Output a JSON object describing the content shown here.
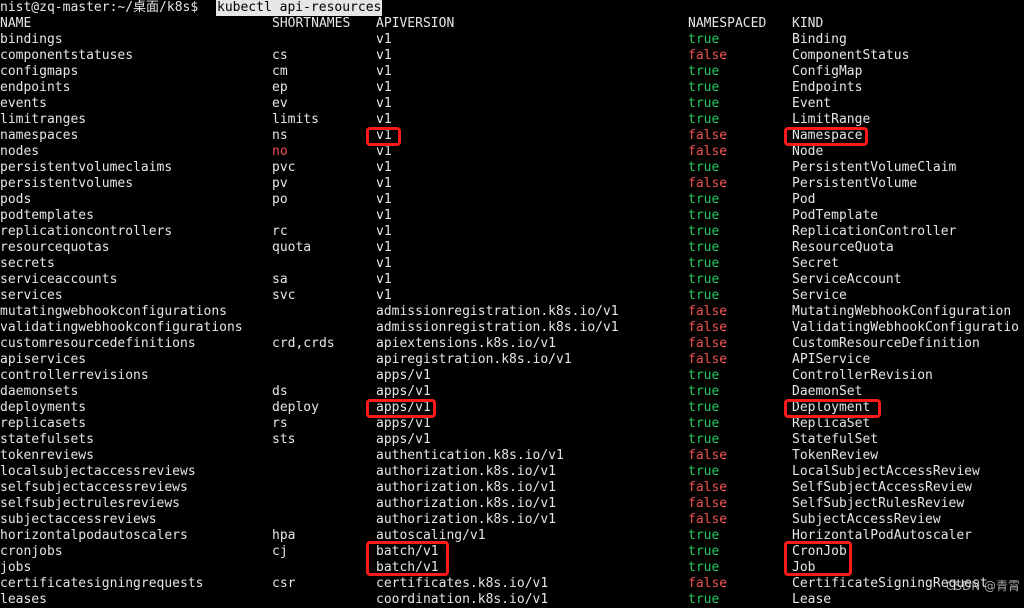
{
  "terminal": {
    "prompt": "nist@zq-master:~/桌面/k8s$ ",
    "command": "kubectl api-resources",
    "headers": {
      "name": "NAME",
      "shortnames": "SHORTNAMES",
      "apiversion": "APIVERSION",
      "namespaced": "NAMESPACED",
      "kind": "KIND"
    },
    "rows": [
      {
        "name": "bindings",
        "short": "",
        "api": "v1",
        "ns": "true",
        "kind": "Binding"
      },
      {
        "name": "componentstatuses",
        "short": "cs",
        "api": "v1",
        "ns": "false",
        "kind": "ComponentStatus"
      },
      {
        "name": "configmaps",
        "short": "cm",
        "api": "v1",
        "ns": "true",
        "kind": "ConfigMap"
      },
      {
        "name": "endpoints",
        "short": "ep",
        "api": "v1",
        "ns": "true",
        "kind": "Endpoints"
      },
      {
        "name": "events",
        "short": "ev",
        "api": "v1",
        "ns": "true",
        "kind": "Event"
      },
      {
        "name": "limitranges",
        "short": "limits",
        "api": "v1",
        "ns": "true",
        "kind": "LimitRange"
      },
      {
        "name": "namespaces",
        "short": "ns",
        "api": "v1",
        "ns": "false",
        "kind": "Namespace"
      },
      {
        "name": "nodes",
        "short": "no",
        "api": "v1",
        "ns": "false",
        "kind": "Node"
      },
      {
        "name": "persistentvolumeclaims",
        "short": "pvc",
        "api": "v1",
        "ns": "true",
        "kind": "PersistentVolumeClaim"
      },
      {
        "name": "persistentvolumes",
        "short": "pv",
        "api": "v1",
        "ns": "false",
        "kind": "PersistentVolume"
      },
      {
        "name": "pods",
        "short": "po",
        "api": "v1",
        "ns": "true",
        "kind": "Pod"
      },
      {
        "name": "podtemplates",
        "short": "",
        "api": "v1",
        "ns": "true",
        "kind": "PodTemplate"
      },
      {
        "name": "replicationcontrollers",
        "short": "rc",
        "api": "v1",
        "ns": "true",
        "kind": "ReplicationController"
      },
      {
        "name": "resourcequotas",
        "short": "quota",
        "api": "v1",
        "ns": "true",
        "kind": "ResourceQuota"
      },
      {
        "name": "secrets",
        "short": "",
        "api": "v1",
        "ns": "true",
        "kind": "Secret"
      },
      {
        "name": "serviceaccounts",
        "short": "sa",
        "api": "v1",
        "ns": "true",
        "kind": "ServiceAccount"
      },
      {
        "name": "services",
        "short": "svc",
        "api": "v1",
        "ns": "true",
        "kind": "Service"
      },
      {
        "name": "mutatingwebhookconfigurations",
        "short": "",
        "api": "admissionregistration.k8s.io/v1",
        "ns": "false",
        "kind": "MutatingWebhookConfiguration"
      },
      {
        "name": "validatingwebhookconfigurations",
        "short": "",
        "api": "admissionregistration.k8s.io/v1",
        "ns": "false",
        "kind": "ValidatingWebhookConfiguratio"
      },
      {
        "name": "customresourcedefinitions",
        "short": "crd,crds",
        "api": "apiextensions.k8s.io/v1",
        "ns": "false",
        "kind": "CustomResourceDefinition"
      },
      {
        "name": "apiservices",
        "short": "",
        "api": "apiregistration.k8s.io/v1",
        "ns": "false",
        "kind": "APIService"
      },
      {
        "name": "controllerrevisions",
        "short": "",
        "api": "apps/v1",
        "ns": "true",
        "kind": "ControllerRevision"
      },
      {
        "name": "daemonsets",
        "short": "ds",
        "api": "apps/v1",
        "ns": "true",
        "kind": "DaemonSet"
      },
      {
        "name": "deployments",
        "short": "deploy",
        "api": "apps/v1",
        "ns": "true",
        "kind": "Deployment"
      },
      {
        "name": "replicasets",
        "short": "rs",
        "api": "apps/v1",
        "ns": "true",
        "kind": "ReplicaSet"
      },
      {
        "name": "statefulsets",
        "short": "sts",
        "api": "apps/v1",
        "ns": "true",
        "kind": "StatefulSet"
      },
      {
        "name": "tokenreviews",
        "short": "",
        "api": "authentication.k8s.io/v1",
        "ns": "false",
        "kind": "TokenReview"
      },
      {
        "name": "localsubjectaccessreviews",
        "short": "",
        "api": "authorization.k8s.io/v1",
        "ns": "true",
        "kind": "LocalSubjectAccessReview"
      },
      {
        "name": "selfsubjectaccessreviews",
        "short": "",
        "api": "authorization.k8s.io/v1",
        "ns": "false",
        "kind": "SelfSubjectAccessReview"
      },
      {
        "name": "selfsubjectrulesreviews",
        "short": "",
        "api": "authorization.k8s.io/v1",
        "ns": "false",
        "kind": "SelfSubjectRulesReview"
      },
      {
        "name": "subjectaccessreviews",
        "short": "",
        "api": "authorization.k8s.io/v1",
        "ns": "false",
        "kind": "SubjectAccessReview"
      },
      {
        "name": "horizontalpodautoscalers",
        "short": "hpa",
        "api": "autoscaling/v1",
        "ns": "true",
        "kind": "HorizontalPodAutoscaler"
      },
      {
        "name": "cronjobs",
        "short": "cj",
        "api": "batch/v1",
        "ns": "true",
        "kind": "CronJob"
      },
      {
        "name": "jobs",
        "short": "",
        "api": "batch/v1",
        "ns": "true",
        "kind": "Job"
      },
      {
        "name": "certificatesigningrequests",
        "short": "csr",
        "api": "certificates.k8s.io/v1",
        "ns": "false",
        "kind": "CertificateSigningRequest"
      },
      {
        "name": "leases",
        "short": "",
        "api": "coordination.k8s.io/v1",
        "ns": "true",
        "kind": "Lease"
      }
    ]
  },
  "colors": {
    "true": "#22c55e",
    "false": "#f05252",
    "highlight": "#ff1a1a",
    "background": "#000000",
    "text": "#e5e5e5"
  },
  "watermark": "CSDN @青霄"
}
